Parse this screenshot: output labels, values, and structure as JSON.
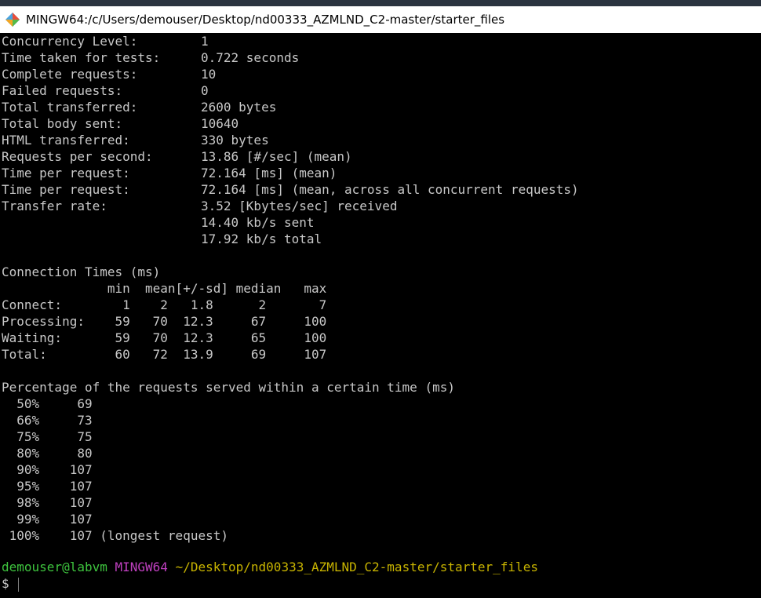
{
  "window": {
    "title": "MINGW64:/c/Users/demouser/Desktop/nd00333_AZMLND_C2-master/starter_files"
  },
  "stats": [
    {
      "label": "Concurrency Level:",
      "value": "1"
    },
    {
      "label": "Time taken for tests:",
      "value": "0.722 seconds"
    },
    {
      "label": "Complete requests:",
      "value": "10"
    },
    {
      "label": "Failed requests:",
      "value": "0"
    },
    {
      "label": "Total transferred:",
      "value": "2600 bytes"
    },
    {
      "label": "Total body sent:",
      "value": "10640"
    },
    {
      "label": "HTML transferred:",
      "value": "330 bytes"
    },
    {
      "label": "Requests per second:",
      "value": "13.86 [#/sec] (mean)"
    },
    {
      "label": "Time per request:",
      "value": "72.164 [ms] (mean)"
    },
    {
      "label": "Time per request:",
      "value": "72.164 [ms] (mean, across all concurrent requests)"
    },
    {
      "label": "Transfer rate:",
      "value": "3.52 [Kbytes/sec] received"
    },
    {
      "label": "",
      "value": "14.40 kb/s sent"
    },
    {
      "label": "",
      "value": "17.92 kb/s total"
    }
  ],
  "connection_times": {
    "heading": "Connection Times (ms)",
    "header": "              min  mean[+/-sd] median   max",
    "rows": [
      "Connect:        1    2   1.8      2       7",
      "Processing:    59   70  12.3     67     100",
      "Waiting:       59   70  12.3     65     100",
      "Total:         60   72  13.9     69     107"
    ]
  },
  "percentiles": {
    "heading": "Percentage of the requests served within a certain time (ms)",
    "rows": [
      "  50%     69",
      "  66%     73",
      "  75%     75",
      "  80%     80",
      "  90%    107",
      "  95%    107",
      "  98%    107",
      "  99%    107",
      " 100%    107 (longest request)"
    ]
  },
  "prompt": {
    "user_host": "demouser@labvm",
    "shell": "MINGW64",
    "path": "~/Desktop/nd00333_AZMLND_C2-master/starter_files",
    "symbol": "$"
  },
  "colors": {
    "prompt_user": "#3ec43e",
    "prompt_shell": "#c040c0",
    "prompt_path": "#c8b400",
    "text": "#c8c8c8",
    "background": "#000000"
  }
}
